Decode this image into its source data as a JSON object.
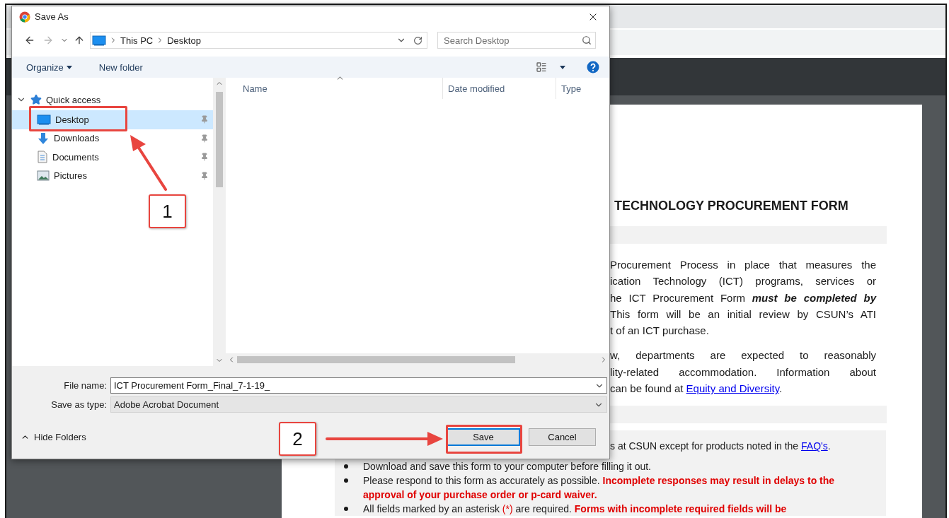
{
  "dialog": {
    "title": "Save As",
    "path": [
      "This PC",
      "Desktop"
    ],
    "search": {
      "placeholder": "Search Desktop"
    },
    "commands": [
      {
        "label": "Organize",
        "dropdown": true
      },
      {
        "label": "New folder",
        "dropdown": false
      }
    ],
    "navigation": [
      {
        "label": "Quick access",
        "expanded": true,
        "children": [
          {
            "label": "Desktop",
            "kind": "desktop",
            "selected": true,
            "pinned": true
          },
          {
            "label": "Downloads",
            "kind": "downloads",
            "selected": false,
            "pinned": true
          },
          {
            "label": "Documents",
            "kind": "documents",
            "selected": false,
            "pinned": true
          },
          {
            "label": "Pictures",
            "kind": "pictures",
            "selected": false,
            "pinned": true
          }
        ]
      }
    ],
    "columns": [
      "Name",
      "Date modified",
      "Type"
    ],
    "file_name": {
      "label": "File name:",
      "value": "ICT Procurement Form_Final_7-1-19_"
    },
    "save_as_type": {
      "label": "Save as type:",
      "value": "Adobe Acrobat Document"
    },
    "hide_folders": "Hide Folders",
    "buttons": [
      {
        "label": "Save",
        "default": true
      },
      {
        "label": "Cancel",
        "default": false
      }
    ]
  },
  "document": {
    "title": "TECHNOLOGY PROCUREMENT FORM",
    "paragraphs": [
      [
        [
          {
            "text": "Procurement Process in place that measures the",
            "kind": "plain"
          }
        ],
        [
          {
            "text": "ication Technology (ICT) programs, services or",
            "kind": "plain"
          }
        ],
        [
          {
            "text": "he ICT Procurement Form ",
            "kind": "plain"
          },
          {
            "text": "must be completed by",
            "kind": "emphasis"
          }
        ],
        [
          {
            "text": "This form will be an initial review by CSUN’s ATI",
            "kind": "plain"
          }
        ],
        [
          {
            "text": "t of an ICT purchase.",
            "kind": "plain"
          }
        ]
      ],
      [
        [
          {
            "text": "w, departments are expected to reasonably",
            "kind": "plain"
          }
        ],
        [
          {
            "text": "lity-related accommodation. Information about",
            "kind": "plain"
          }
        ],
        [
          {
            "text": "can be found at ",
            "kind": "plain"
          },
          {
            "text": "Equity and Diversity",
            "kind": "link"
          },
          {
            "text": ".",
            "kind": "plain"
          }
        ]
      ]
    ],
    "notice_tail": [
      {
        "text": "s at CSUN except for products noted in the ",
        "kind": "plain"
      },
      {
        "text": "FAQ's",
        "kind": "link"
      },
      {
        "text": ".",
        "kind": "plain"
      }
    ],
    "bullets": [
      [
        {
          "text": "Download and save this form to your computer before filling it out.",
          "kind": "plain"
        }
      ],
      [
        {
          "text": "Please respond to this form as accurately as possible. ",
          "kind": "plain"
        },
        {
          "text": "Incomplete responses may result in delays to the approval of your purchase order or p-card waiver.",
          "kind": "alert-strong"
        }
      ],
      [
        {
          "text": "All fields marked by an asterisk ",
          "kind": "plain"
        },
        {
          "text": "(*)",
          "kind": "alert"
        },
        {
          "text": " are required. ",
          "kind": "plain"
        },
        {
          "text": "Forms with incomplete required fields will be",
          "kind": "alert-strong"
        }
      ]
    ]
  },
  "annotations": [
    {
      "label": "1"
    },
    {
      "label": "2"
    }
  ]
}
